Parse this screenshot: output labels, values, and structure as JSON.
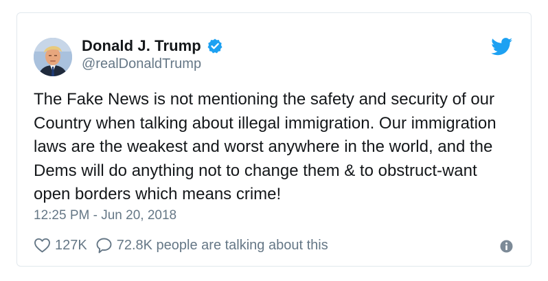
{
  "author": {
    "display_name": "Donald J. Trump",
    "handle": "@realDonaldTrump",
    "verified": true,
    "avatar_icon": "profile-photo"
  },
  "tweet": {
    "text": "The Fake News is not mentioning the safety and security of our Country when talking about illegal immigration. Our immigration laws are the weakest and worst anywhere in the world, and the Dems will do anything not to change them & to obstruct-want open borders which means crime!",
    "timestamp": "12:25 PM - Jun 20, 2018"
  },
  "engagement": {
    "like_count": "127K",
    "talking_count": "72.8K people are talking about this"
  },
  "icons": {
    "brand": "twitter-bird-icon",
    "verified": "verified-badge-icon",
    "like": "heart-icon",
    "reply": "comment-icon",
    "info": "info-icon"
  },
  "colors": {
    "brand_blue": "#1da1f2",
    "text_primary": "#14171a",
    "text_secondary": "#657786",
    "border": "#e1e8ed"
  }
}
